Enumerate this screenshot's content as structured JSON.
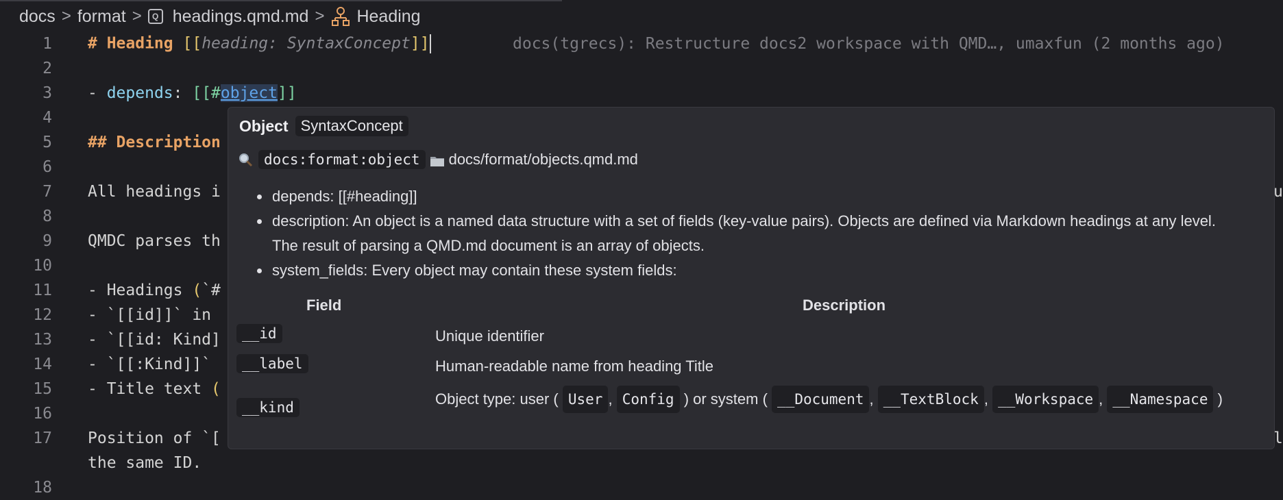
{
  "breadcrumb": {
    "items": [
      "docs",
      "format",
      "headings.qmd.md",
      "Heading"
    ],
    "separator": ">"
  },
  "editor": {
    "lines": [
      {
        "n": "1"
      },
      {
        "n": "2"
      },
      {
        "n": "3"
      },
      {
        "n": "4"
      },
      {
        "n": "5"
      },
      {
        "n": "6"
      },
      {
        "n": "7"
      },
      {
        "n": "8"
      },
      {
        "n": "9"
      },
      {
        "n": "10"
      },
      {
        "n": "11"
      },
      {
        "n": "12"
      },
      {
        "n": "13"
      },
      {
        "n": "14"
      },
      {
        "n": "15"
      },
      {
        "n": "16"
      },
      {
        "n": "17"
      },
      {
        "n": "18"
      }
    ],
    "l1": {
      "hash": "# Heading ",
      "open1": "[",
      "open2": "[",
      "ital": "heading: SyntaxConcept",
      "close1": "]",
      "close2": "]"
    },
    "blame": "docs(tgrecs): Restructure docs2 workspace with QMD…, umaxfun (2 months ago)",
    "l3": {
      "dash": "- ",
      "key": "depends",
      "colon": ": ",
      "open": "[[#",
      "link": "object",
      "close": "]]"
    },
    "l5": "## Description",
    "l7": "All headings i",
    "l7_tail": "u",
    "l9": "QMDC parses th",
    "l11": {
      "text": "- Headings ",
      "paren": "(",
      "rest": "`#"
    },
    "l12": "- `[[id]]` in ",
    "l13": "- `[[id: Kind]",
    "l14": "- `[[:Kind]]` ",
    "l15": {
      "text": "- Title text ",
      "paren": "("
    },
    "l17": "Position of `[",
    "l17_tail": "l",
    "l17b": "the same ID."
  },
  "hover": {
    "title": "Object",
    "kind": "SyntaxConcept",
    "id": "docs:format:object",
    "path": "docs/format/objects.qmd.md",
    "bullets": [
      "depends: [[#heading]]",
      "description: An object is a named data structure with a set of fields (key-value pairs). Objects are defined via Markdown headings at any level. The result of parsing a QMD.md document is an array of objects.",
      "system_fields: Every object may contain these system fields:"
    ],
    "table": {
      "headers": [
        "Field",
        "Description"
      ],
      "rows": [
        {
          "field": "__id",
          "desc": "Unique identifier"
        },
        {
          "field": "__label",
          "desc": "Human-readable name from heading Title"
        }
      ],
      "kind_row": {
        "field": "__kind",
        "d1": "Object type: user (",
        "c1": "User",
        "d2": ",",
        "c2": "Config",
        "d3": ") or system (",
        "c3": "__Document",
        "d4": ",",
        "c4": "__TextBlock",
        "d5": ",",
        "c5": "__Workspace",
        "d6": ",",
        "c6": "__Namespace",
        "d7": ")"
      }
    }
  },
  "colors": {
    "background": "#1e1e22",
    "heading": "#e8a365",
    "link": "#5fa3e8",
    "key": "#8fd4f0",
    "bracket_yellow": "#e6c86e",
    "bracket_green": "#7ed4a4",
    "hover_bg": "#2c2c31"
  }
}
